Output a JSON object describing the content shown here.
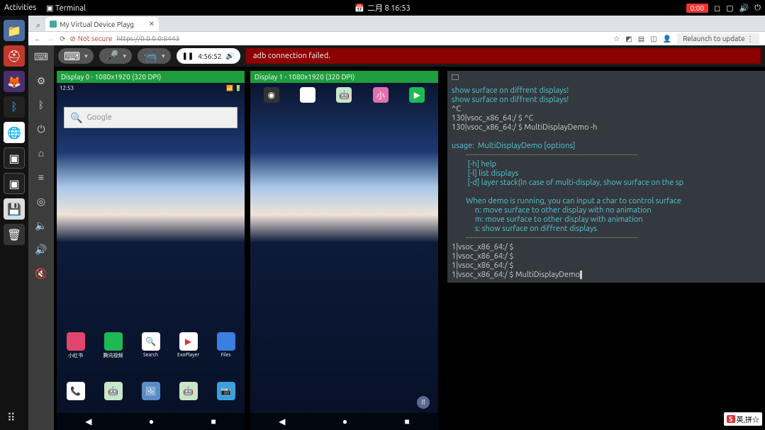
{
  "osbar": {
    "activities": "Activities",
    "terminal": "Terminal",
    "date": "二月 8  16:53",
    "badge": "0:00",
    "icons": [
      "notify-icon",
      "square-icon",
      "volume-icon",
      "power-icon"
    ]
  },
  "dock": {
    "apps_label": "⠿"
  },
  "browser": {
    "tab_title": "My Virtual Device Playg",
    "not_secure": "Not secure",
    "url": "https://0.0.0.0:8443",
    "relaunch": "Relaunch to update"
  },
  "toolbar": {
    "play_time": "4:56:52",
    "error": "adb connection failed."
  },
  "display0": {
    "header": "Display 0 - 1080x1920 (320 DPI)",
    "status_time": "12:53",
    "search_placeholder": "Google",
    "apps_r1": [
      {
        "label": "小红书",
        "color": "#e0466b"
      },
      {
        "label": "腾讯视频",
        "color": "#1db954"
      },
      {
        "label": "Search",
        "color": "#fff"
      },
      {
        "label": "ExoPlayer",
        "color": "#fff"
      },
      {
        "label": "Files",
        "color": "#3a7ee0"
      }
    ],
    "apps_r2": [
      {
        "label": "",
        "color": "#fff",
        "glyph": "📞"
      },
      {
        "label": "",
        "color": "#c8e6c9",
        "glyph": "🤖"
      },
      {
        "label": "",
        "color": "#5a8cc8",
        "glyph": "🖼"
      },
      {
        "label": "",
        "color": "#c8e6c9",
        "glyph": "🤖"
      },
      {
        "label": "",
        "color": "#3aa0e0",
        "glyph": "📷"
      }
    ]
  },
  "display1": {
    "header": "Display 1 - 1080x1920 (320 DPI)",
    "apps_top": [
      {
        "color": "#333",
        "glyph": "◉"
      },
      {
        "color": "#fff",
        "glyph": "▶"
      },
      {
        "color": "#c8e6c9",
        "glyph": "🤖"
      },
      {
        "color": "#e070b0",
        "glyph": "小"
      },
      {
        "color": "#1db954",
        "glyph": "▶"
      }
    ]
  },
  "terminal": {
    "lines": [
      {
        "t": "show surface on diffrent displays!",
        "c": "cyan"
      },
      {
        "t": "show surface on diffrent displays!",
        "c": "cyan"
      },
      {
        "t": "^C",
        "c": ""
      },
      {
        "t": "130|vsoc_x86_64:/ $ ^C",
        "c": ""
      },
      {
        "t": "130|vsoc_x86_64:/ $ MultiDisplayDemo -h",
        "c": ""
      },
      {
        "t": "",
        "c": ""
      },
      {
        "t": "usage:  MultiDisplayDemo [options]",
        "c": "cyan"
      },
      {
        "t": "        ----------------------------------------------------------------------------",
        "c": "dashes"
      },
      {
        "t": "         [-h] help",
        "c": "cyan"
      },
      {
        "t": "         [-l] list displays",
        "c": "cyan"
      },
      {
        "t": "         [-d] layer stack(In case of multi-display, show surface on the sp",
        "c": "cyan"
      },
      {
        "t": "",
        "c": ""
      },
      {
        "t": "        When demo is running, you can input a char to control surface",
        "c": "cyan"
      },
      {
        "t": "             n: move surface to other display with no animation",
        "c": "cyan"
      },
      {
        "t": "             m: move surface to other display with animation",
        "c": "cyan"
      },
      {
        "t": "             s: show surface on diffrent displays",
        "c": "cyan"
      },
      {
        "t": "        ----------------------------------------------------------------------------",
        "c": "dashes"
      },
      {
        "t": "1|vsoc_x86_64:/ $",
        "c": ""
      },
      {
        "t": "1|vsoc_x86_64:/ $",
        "c": ""
      },
      {
        "t": "1|vsoc_x86_64:/ $",
        "c": ""
      }
    ],
    "prompt": "1|vsoc_x86_64:/ $ ",
    "cmd": "MultiDisplayDemo"
  },
  "ime": {
    "s": "S",
    "text": "英,拼☆"
  }
}
